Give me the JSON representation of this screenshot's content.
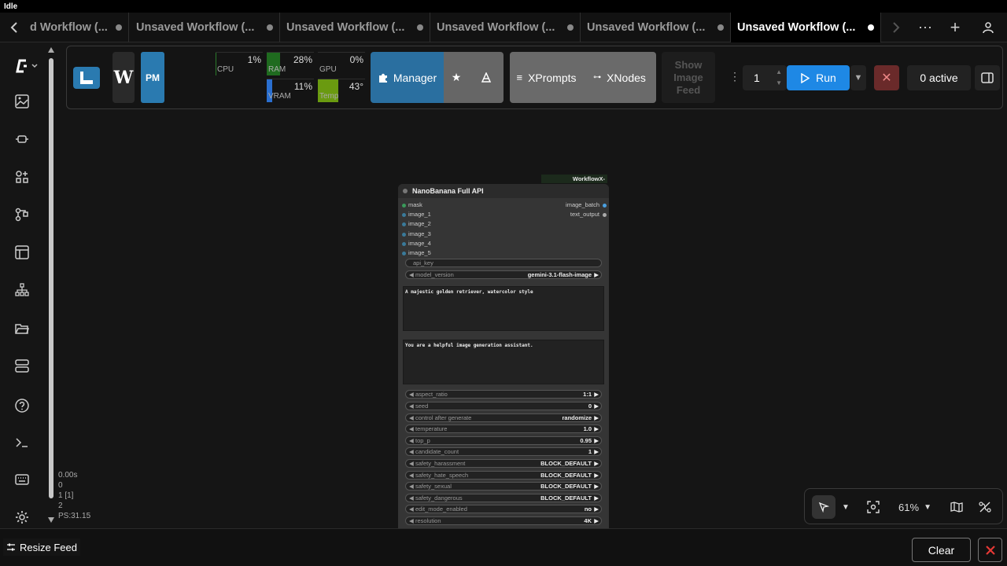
{
  "window": {
    "status": "Idle"
  },
  "tabs": [
    {
      "label": "d Workflow (..."
    },
    {
      "label": "Unsaved Workflow (..."
    },
    {
      "label": "Unsaved Workflow (..."
    },
    {
      "label": "Unsaved Workflow (..."
    },
    {
      "label": "Unsaved Workflow (..."
    },
    {
      "label": "Unsaved Workflow (...",
      "active": true
    }
  ],
  "sidebar": {
    "icons": [
      "logo-icon",
      "images-icon",
      "model-icon",
      "node-library-icon",
      "workflows-icon",
      "templates-icon",
      "queue-icon",
      "folder-icon",
      "layout-icon",
      "help-icon",
      "terminal-icon",
      "keyboard-icon",
      "settings-icon"
    ]
  },
  "toolbar": {
    "logo_pm": "PM",
    "logo_w": "W",
    "meters": {
      "cpu": {
        "label": "CPU",
        "value": "1%",
        "level": 0.01
      },
      "ram": {
        "label": "RAM",
        "value": "28%",
        "level": 0.28
      },
      "gpu": {
        "label": "GPU",
        "value": "0%",
        "level": 0.0
      },
      "vram": {
        "label": "VRAM",
        "value": "11%",
        "level": 0.11
      },
      "temp": {
        "label": "Temp",
        "value": "43°",
        "level": 0.43
      }
    },
    "manager_label": "Manager",
    "xprompts_label": "XPrompts",
    "xnodes_label": "XNodes",
    "feed_label_1": "Show",
    "feed_label_2": "Image",
    "feed_label_3": "Feed",
    "batch_count": "1",
    "run_label": "Run",
    "active_label": "0 active"
  },
  "node": {
    "badge": "WorkflowX-Configurator",
    "title": "NanoBanana Full API",
    "inputs": [
      "mask",
      "image_1",
      "image_2",
      "image_3",
      "image_4",
      "image_5"
    ],
    "outputs": [
      "image_batch",
      "text_output"
    ],
    "api_key_placeholder": "api_key",
    "model_version": {
      "name": "model_version",
      "value": "gemini-3.1-flash-image"
    },
    "prompt": "A majestic golden retriever, watercolor style",
    "system_prompt": "You are a helpful image generation assistant.",
    "widgets": [
      {
        "name": "aspect_ratio",
        "value": "1:1"
      },
      {
        "name": "seed",
        "value": "0"
      },
      {
        "name": "control after generate",
        "value": "randomize"
      },
      {
        "name": "temperature",
        "value": "1.0"
      },
      {
        "name": "top_p",
        "value": "0.95"
      },
      {
        "name": "candidate_count",
        "value": "1"
      },
      {
        "name": "safety_harassment",
        "value": "BLOCK_DEFAULT"
      },
      {
        "name": "safety_hate_speech",
        "value": "BLOCK_DEFAULT"
      },
      {
        "name": "safety_sexual",
        "value": "BLOCK_DEFAULT"
      },
      {
        "name": "safety_dangerous",
        "value": "BLOCK_DEFAULT"
      },
      {
        "name": "edit_mode_enabled",
        "value": "no"
      },
      {
        "name": "resolution",
        "value": "4K"
      }
    ]
  },
  "stats": {
    "line1": "0.00s",
    "line2": "0",
    "line3": "1 [1]",
    "line4": "2",
    "line5": "PS:31.15"
  },
  "canvas_controls": {
    "zoom": "61%"
  },
  "bottom": {
    "resize_label": "Resize Feed",
    "clear_label": "Clear"
  },
  "colors": {
    "accent": "#1e88e5",
    "manager": "#2a6fa0",
    "cancel": "#6a2a2a"
  }
}
